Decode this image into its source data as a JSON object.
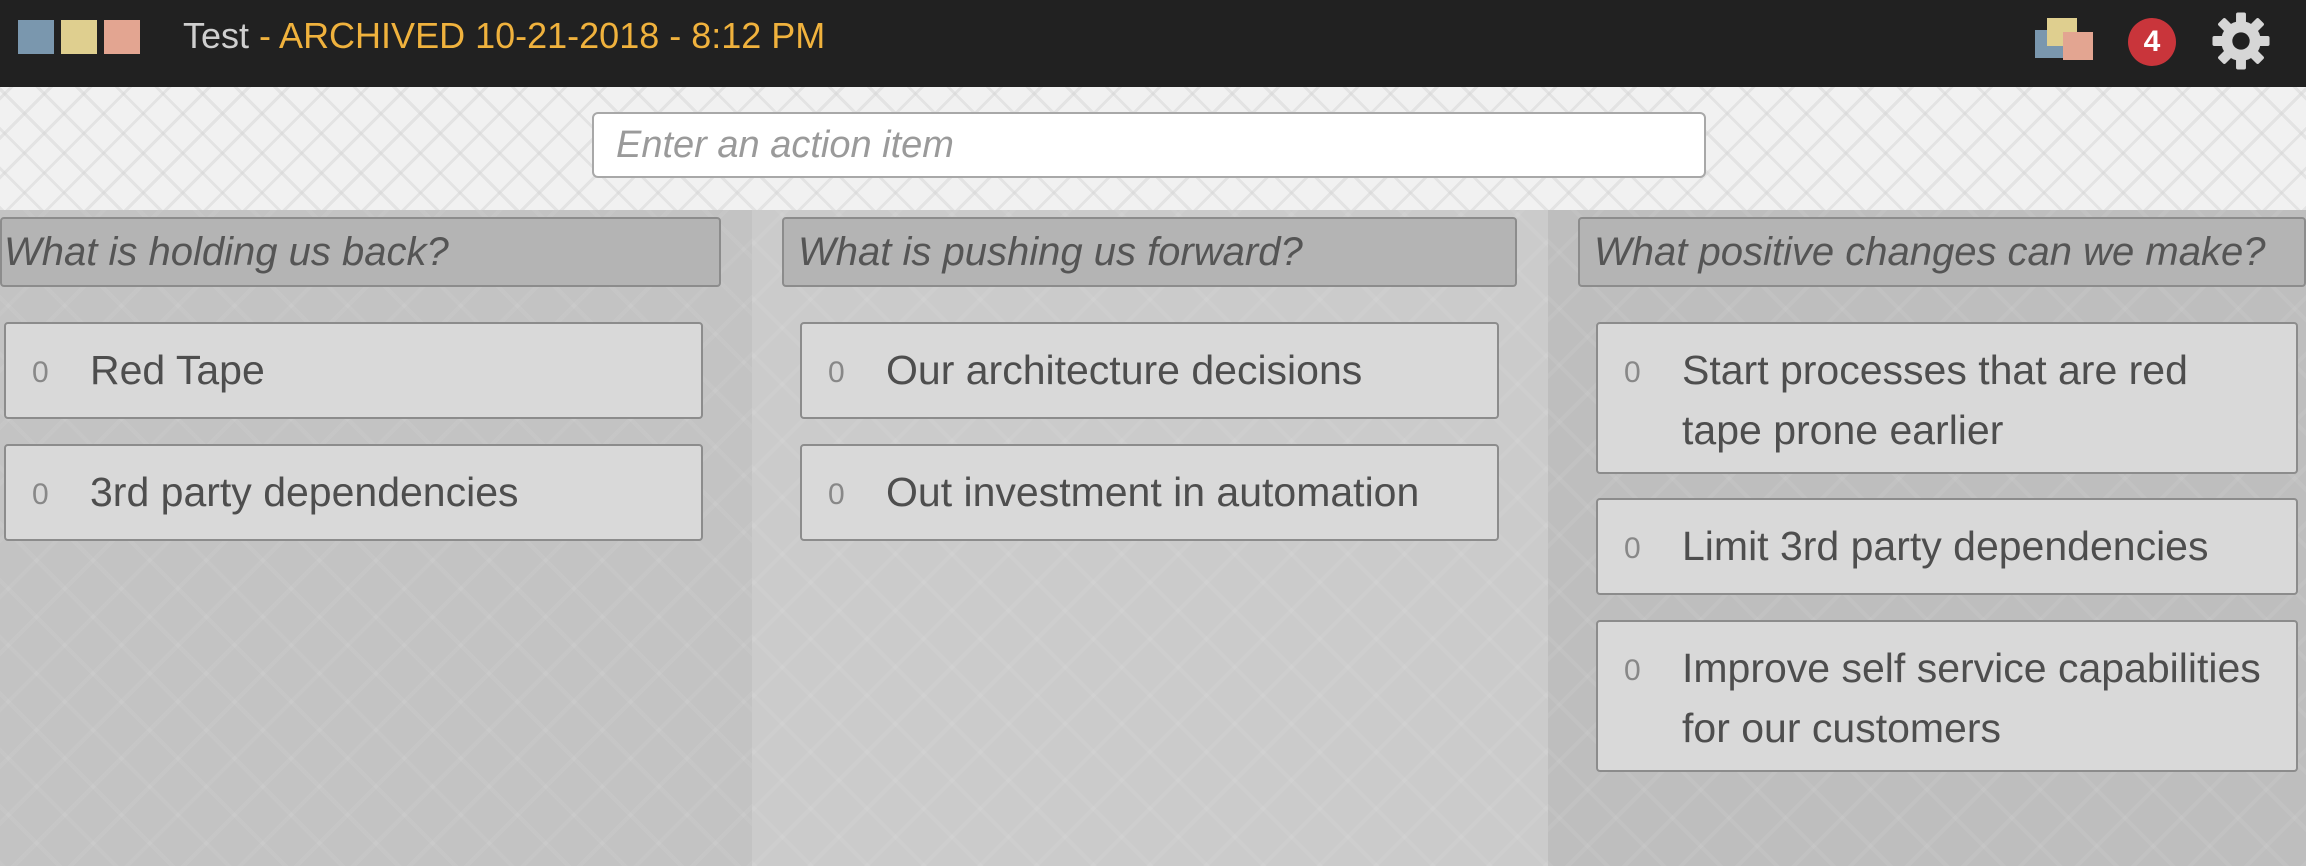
{
  "header": {
    "board_name": "Test",
    "archived_label": "- ARCHIVED 10-21-2018 - 8:12 PM",
    "notification_count": "4",
    "colors": {
      "blue": "#7a97ae",
      "yellow": "#dfcf8f",
      "pink": "#e3a591",
      "accent": "#f0b23d",
      "badge": "#c9353b"
    }
  },
  "action_input": {
    "placeholder": "Enter an action item",
    "value": ""
  },
  "columns": [
    {
      "title": "What is holding us back?",
      "items": [
        {
          "count": "0",
          "text": "Red Tape"
        },
        {
          "count": "0",
          "text": "3rd party dependencies"
        }
      ]
    },
    {
      "title": "What is pushing us forward?",
      "items": [
        {
          "count": "0",
          "text": "Our architecture decisions"
        },
        {
          "count": "0",
          "text": "Out investment in automation"
        }
      ]
    },
    {
      "title": "What positive changes can we make?",
      "items": [
        {
          "count": "0",
          "text": "Start processes that are red tape prone earlier"
        },
        {
          "count": "0",
          "text": "Limit 3rd party dependencies"
        },
        {
          "count": "0",
          "text": "Improve self service capabilities for our customers"
        }
      ]
    }
  ]
}
